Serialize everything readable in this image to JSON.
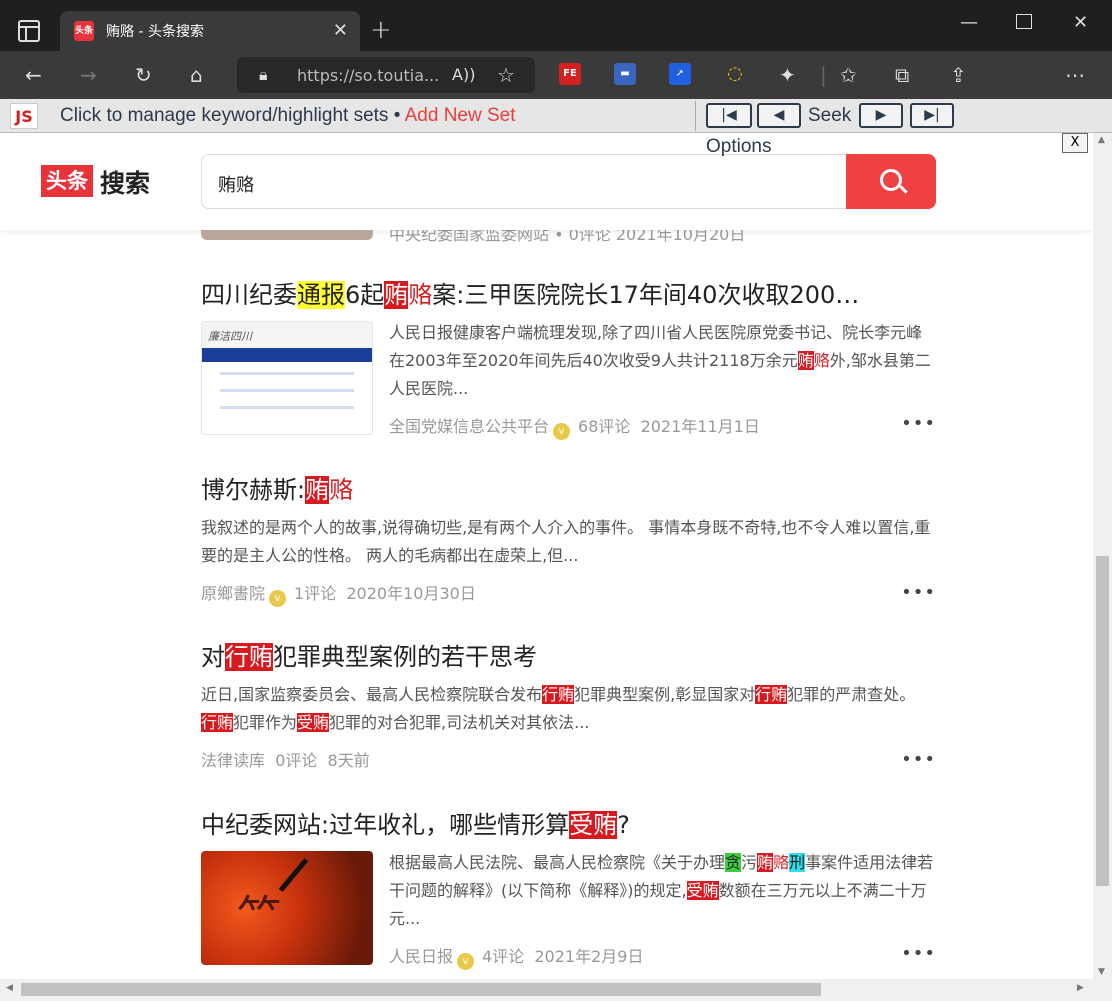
{
  "browser": {
    "tab_title": "贿赂 - 头条搜索",
    "tab_favicon_text": "头条",
    "url": "https://so.toutia..."
  },
  "jsbar": {
    "logo": "JS",
    "manage": "Click to manage keyword/highlight sets • ",
    "add_new": "Add New Set",
    "seek": "Seek",
    "options": "Options",
    "close": "X"
  },
  "header": {
    "logo_box": "头条",
    "logo_text": "搜索",
    "search_value": "贿赂"
  },
  "partial_meta": "中央纪委国家监委网站 • 0评论  2021年10月20日",
  "results": [
    {
      "title_parts": [
        "四川纪委",
        "通报",
        "6起",
        "贿",
        "赂",
        "案:三甲医院院长17年间40次收取200…"
      ],
      "snippet": [
        "人民日报健康客户端梳理发现,除了四川省人民医院原党委书记、院长李元峰在2003年至2020年间先后40次收受9人共计2118万余元",
        "贿",
        "赂",
        "外,邹水县第二人民医院..."
      ],
      "source": "全国党媒信息公共平台",
      "comments": "68评论",
      "date": "2021年11月1日",
      "thumb_text": "廉洁四川"
    },
    {
      "title_parts": [
        "博尔赫斯:",
        "贿",
        "赂"
      ],
      "snippet": [
        "我叙述的是两个人的故事,说得确切些,是有两个人介入的事件。 事情本身既不奇特,也不令人难以置信,重要的是主人公的性格。 两人的毛病都出在虚荣上,但..."
      ],
      "source": "原鄉書院",
      "comments": "1评论",
      "date": "2020年10月30日"
    },
    {
      "title_parts": [
        "对",
        "行贿",
        "犯罪典型案例的若干思考"
      ],
      "snippet": [
        "近日,国家监察委员会、最高人民检察院联合发布",
        "行贿",
        "犯罪典型案例,彰显国家对",
        "行贿",
        "犯罪的严肃查处。 ",
        "行贿",
        "犯罪作为",
        "受贿",
        "犯罪的对合犯罪,司法机关对其依法..."
      ],
      "source": "法律读库",
      "comments": "0评论",
      "date": "8天前"
    },
    {
      "title_parts": [
        "中纪委网站:过年收礼，哪些情形算",
        "受贿",
        "?"
      ],
      "snippet": [
        "根据最高人民法院、最高人民检察院《关于办理",
        "贪",
        "污",
        "贿",
        "赂",
        "刑",
        "事案件适用法律若干问题的解释》(以下简称《解释》)的规定,",
        "受贿",
        "数额在三万元以上不满二十万元..."
      ],
      "source": "人民日报",
      "comments": "4评论",
      "date": "2021年2月9日"
    }
  ],
  "more_label": "•••",
  "icons": [
    "window-icon",
    "close-icon",
    "plus-icon",
    "back-icon",
    "forward-icon",
    "refresh-icon",
    "home-icon",
    "lock-icon",
    "read-aloud-icon",
    "favorite-add-icon",
    "extension-icon",
    "favorites-icon",
    "collections-icon",
    "share-icon",
    "menu-icon",
    "search-icon"
  ],
  "colors": {
    "brand": "#f04142",
    "highlight_red": "#d71a1f",
    "highlight_yellow": "#ffff33",
    "highlight_green": "#3cd13c",
    "highlight_cyan": "#33ddee"
  }
}
